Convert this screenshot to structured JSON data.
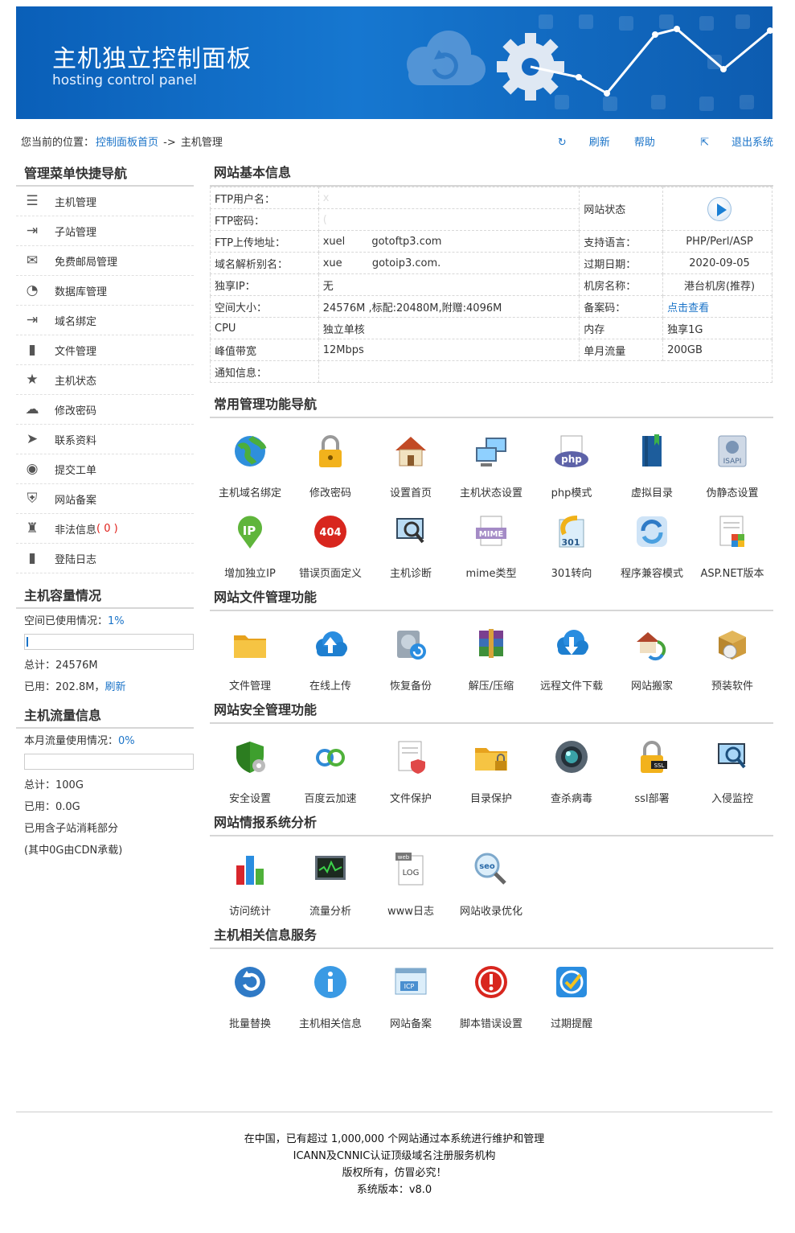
{
  "banner": {
    "title": "主机独立控制面板",
    "subtitle": "hosting control panel"
  },
  "breadcrumb": {
    "prefix": "您当前的位置：",
    "home_link": "控制面板首页",
    "arrow": " -> ",
    "current": "主机管理",
    "refresh": "刷新",
    "help": "帮助",
    "logout": "退出系统"
  },
  "sidebar": {
    "nav_title": "管理菜单快捷导航",
    "items": [
      {
        "label": "主机管理",
        "icon": "database-icon"
      },
      {
        "label": "子站管理",
        "icon": "enter-arrow-icon"
      },
      {
        "label": "免费邮局管理",
        "icon": "envelope-icon"
      },
      {
        "label": "数据库管理",
        "icon": "pie-icon"
      },
      {
        "label": "域名绑定",
        "icon": "enter-arrow-icon"
      },
      {
        "label": "文件管理",
        "icon": "file-icon"
      },
      {
        "label": "主机状态",
        "icon": "star-icon"
      },
      {
        "label": "修改密码",
        "icon": "cloud-icon"
      },
      {
        "label": "联系资料",
        "icon": "send-icon"
      },
      {
        "label": "提交工单",
        "icon": "user-icon"
      },
      {
        "label": "网站备案",
        "icon": "shield-icon"
      },
      {
        "label": "非法信息",
        "icon": "person-icon",
        "badge": "( 0 )"
      },
      {
        "label": "登陆日志",
        "icon": "file-icon"
      }
    ],
    "capacity": {
      "title": "主机容量情况",
      "usage_label": "空间已使用情况：",
      "usage_pct": "1%",
      "usage_value": 0.01,
      "total": "总计：24576M",
      "used": "已用：202.8M，",
      "refresh": "刷新"
    },
    "traffic": {
      "title": "主机流量信息",
      "usage_label": "本月流量使用情况：",
      "usage_pct": "0%",
      "usage_value": 0,
      "total": "总计：100G",
      "used": "已用：0.0G",
      "note1": "已用含子站消耗部分",
      "note2": "(其中0G由CDN承载)"
    }
  },
  "info": {
    "title": "网站基本信息",
    "ftp_user_label": "FTP用户名：",
    "ftp_user": "x",
    "ftp_pass_label": "FTP密码：",
    "ftp_pass": "(",
    "status_label": "网站状态",
    "ftp_addr_label": "FTP上传地址：",
    "ftp_addr": "xuel        gotoftp3.com",
    "lang_label": "支持语言：",
    "lang": "PHP/Perl/ASP",
    "alias_label": "域名解析别名：",
    "alias": "xue         gotoip3.com.",
    "expire_label": "过期日期：",
    "expire": "2020-09-05",
    "ip_label": "独享IP：",
    "ip": "无",
    "room_label": "机房名称：",
    "room": "港台机房(推荐)",
    "space_label": "空间大小：",
    "space": "24576M ,标配:20480M,附赠:4096M",
    "icp_label": "备案码：",
    "icp": "点击查看",
    "cpu_label": "CPU",
    "cpu": "独立单核",
    "mem_label": "内存",
    "mem": "独享1G",
    "bw_label": "峰值带宽",
    "bw": "12Mbps",
    "flow_label": "单月流量",
    "flow": "200GB",
    "notice_label": "通知信息："
  },
  "sections": [
    {
      "title": "常用管理功能导航",
      "tiles": [
        {
          "label": "主机域名绑定",
          "icon": "globe-icon"
        },
        {
          "label": "修改密码",
          "icon": "padlock-icon"
        },
        {
          "label": "设置首页",
          "icon": "house-icon"
        },
        {
          "label": "主机状态设置",
          "icon": "computers-icon"
        },
        {
          "label": "php模式",
          "icon": "php-icon"
        },
        {
          "label": "虚拟目录",
          "icon": "book-icon"
        },
        {
          "label": "伪静态设置",
          "icon": "isapi-icon"
        },
        {
          "label": "增加独立IP",
          "icon": "ip-v4-icon"
        },
        {
          "label": "错误页面定义",
          "icon": "404-icon"
        },
        {
          "label": "主机诊断",
          "icon": "monitor-magnifier-icon"
        },
        {
          "label": "mime类型",
          "icon": "mime-icon"
        },
        {
          "label": "301转向",
          "icon": "redirect-301-icon"
        },
        {
          "label": "程序兼容模式",
          "icon": "sync-icon"
        },
        {
          "label": "ASP.NET版本",
          "icon": "aspnet-icon"
        }
      ]
    },
    {
      "title": "网站文件管理功能",
      "tiles": [
        {
          "label": "文件管理",
          "icon": "folder-icon"
        },
        {
          "label": "在线上传",
          "icon": "cloud-upload-icon"
        },
        {
          "label": "恢复备份",
          "icon": "hdd-restore-icon"
        },
        {
          "label": "解压/压缩",
          "icon": "archive-icon"
        },
        {
          "label": "远程文件下载",
          "icon": "cloud-download-icon"
        },
        {
          "label": "网站搬家",
          "icon": "move-house-icon"
        },
        {
          "label": "预装软件",
          "icon": "software-box-icon"
        }
      ]
    },
    {
      "title": "网站安全管理功能",
      "tiles": [
        {
          "label": "安全设置",
          "icon": "shield-gear-icon"
        },
        {
          "label": "百度云加速",
          "icon": "cloud-link-icon"
        },
        {
          "label": "文件保护",
          "icon": "file-shield-icon"
        },
        {
          "label": "目录保护",
          "icon": "folder-lock-icon"
        },
        {
          "label": "查杀病毒",
          "icon": "camera-lens-icon"
        },
        {
          "label": "ssl部署",
          "icon": "ssl-lock-icon"
        },
        {
          "label": "入侵监控",
          "icon": "monitor-search-icon"
        }
      ]
    },
    {
      "title": "网站情报系统分析",
      "tiles": [
        {
          "label": "访问统计",
          "icon": "bar-chart-icon"
        },
        {
          "label": "流量分析",
          "icon": "monitor-wave-icon"
        },
        {
          "label": "www日志",
          "icon": "log-file-icon"
        },
        {
          "label": "网站收录优化",
          "icon": "seo-magnifier-icon"
        }
      ]
    },
    {
      "title": "主机相关信息服务",
      "tiles": [
        {
          "label": "批量替换",
          "icon": "refresh-circle-icon"
        },
        {
          "label": "主机相关信息",
          "icon": "info-icon"
        },
        {
          "label": "网站备案",
          "icon": "icp-window-icon"
        },
        {
          "label": "脚本错误设置",
          "icon": "alert-icon"
        },
        {
          "label": "过期提醒",
          "icon": "check-badge-icon"
        }
      ]
    }
  ],
  "footer": {
    "line1": "在中国，已有超过 1,000,000 个网站通过本系统进行维护和管理",
    "line2": "ICANN及CNNIC认证顶级域名注册服务机构",
    "line3": "版权所有，仿冒必究！",
    "line4": "系统版本：v8.0"
  }
}
